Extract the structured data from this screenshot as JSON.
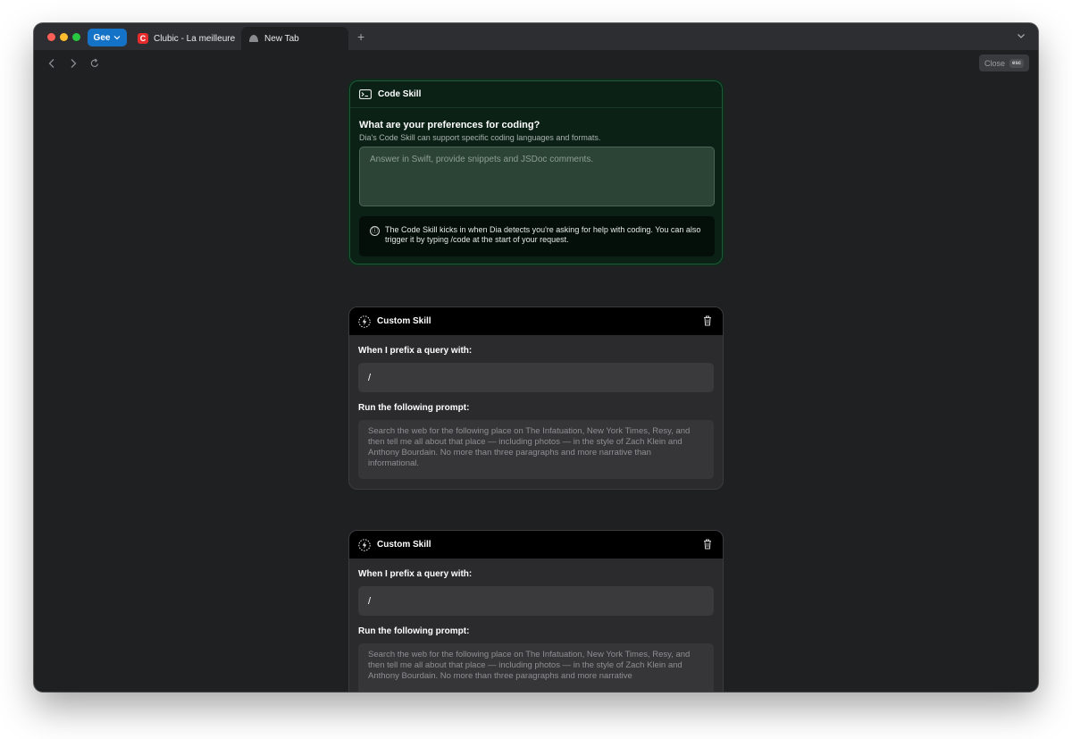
{
  "tabs": {
    "profile": "Gee",
    "items": [
      {
        "title": "Clubic - La meilleure sc",
        "favicon": "C"
      },
      {
        "title": "New Tab"
      }
    ],
    "new_tab_symbol": "+"
  },
  "toolbar": {
    "close_label": "Close",
    "close_shortcut": "esc"
  },
  "code_skill": {
    "title": "Code Skill",
    "question": "What are your preferences for coding?",
    "subtitle": "Dia's Code Skill can support specific coding languages and formats.",
    "placeholder": "Answer in Swift, provide snippets and JSDoc comments.",
    "info_icon": "ⓘ",
    "info": "The Code Skill kicks in when Dia detects you're asking for help with coding. You can also trigger it by typing /code at the start of your request."
  },
  "custom_skills": [
    {
      "title": "Custom Skill",
      "prefix_label": "When I prefix a query with:",
      "prefix_value": "/",
      "prompt_label": "Run the following prompt:",
      "prompt_placeholder": "Search the web for the following place on The Infatuation, New York Times, Resy, and then tell me all about that place — including photos — in the style of Zach Klein and Anthony Bourdain. No more than three paragraphs and more narrative than informational."
    },
    {
      "title": "Custom Skill",
      "prefix_label": "When I prefix a query with:",
      "prefix_value": "/",
      "prompt_label": "Run the following prompt:",
      "prompt_placeholder": "Search the web for the following place on The Infatuation, New York Times, Resy, and then tell me all about that place — including photos — in the style of Zach Klein and Anthony Bourdain. No more than three paragraphs and more narrative"
    }
  ]
}
